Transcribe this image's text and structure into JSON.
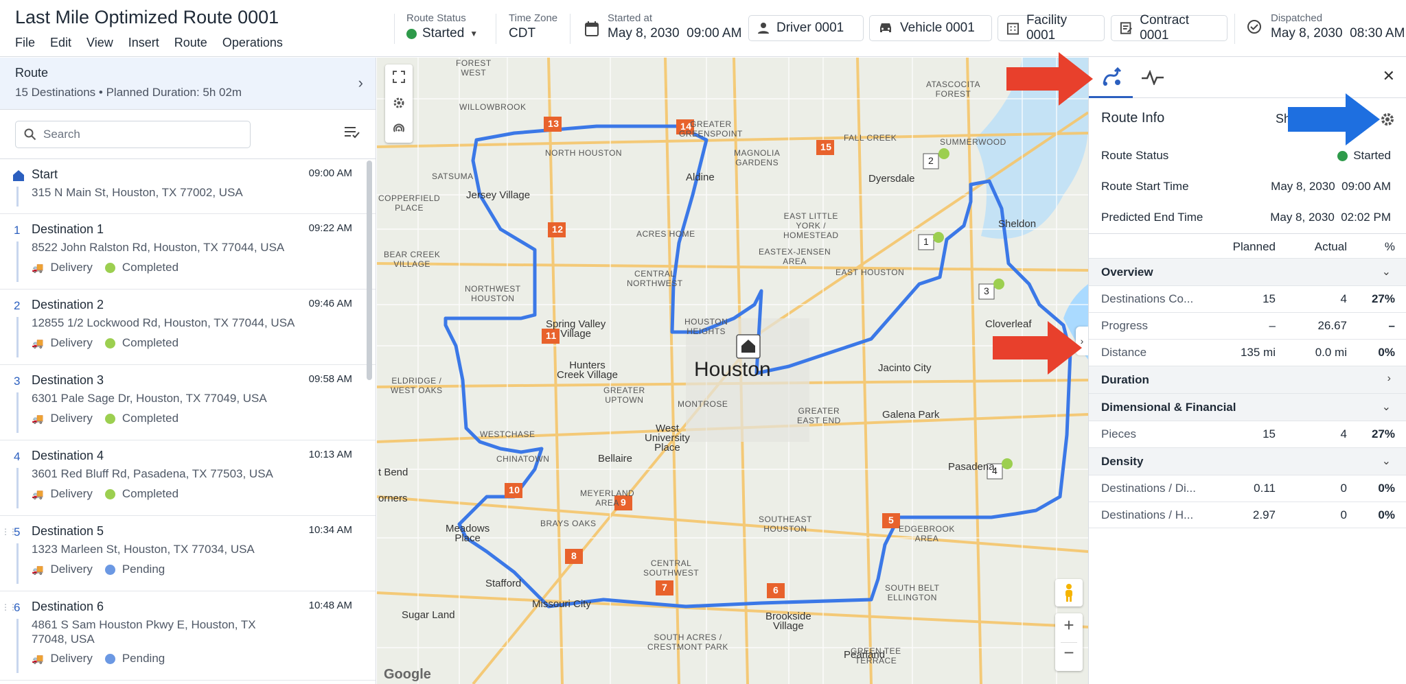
{
  "header": {
    "title": "Last Mile Optimized Route 0001",
    "menu": [
      "File",
      "Edit",
      "View",
      "Insert",
      "Route",
      "Operations"
    ],
    "route_status_label": "Route Status",
    "route_status_value": "Started",
    "time_zone_label": "Time Zone",
    "time_zone_value": "CDT",
    "started_at_label": "Started at",
    "started_at_value": "May 8, 2030  09:00 AM",
    "driver": "Driver 0001",
    "vehicle": "Vehicle 0001",
    "facility": "Facility 0001",
    "contract": "Contract 0001",
    "dispatched_label": "Dispatched",
    "dispatched_value": "May 8, 2030  08:30 AM"
  },
  "left": {
    "route_title": "Route",
    "route_summary": "15 Destinations • Planned Duration: 5h 02m",
    "search_placeholder": "Search",
    "stops": [
      {
        "num": "",
        "name": "Start",
        "time": "09:00 AM",
        "address": "315 N Main St, Houston, TX 77002, USA",
        "type": "",
        "status": ""
      },
      {
        "num": "1",
        "name": "Destination 1",
        "time": "09:22 AM",
        "address": "8522 John Ralston Rd, Houston, TX 77044, USA",
        "type": "Delivery",
        "status": "Completed"
      },
      {
        "num": "2",
        "name": "Destination 2",
        "time": "09:46 AM",
        "address": "12855 1/2 Lockwood Rd, Houston, TX 77044, USA",
        "type": "Delivery",
        "status": "Completed"
      },
      {
        "num": "3",
        "name": "Destination 3",
        "time": "09:58 AM",
        "address": "6301 Pale Sage Dr, Houston, TX 77049, USA",
        "type": "Delivery",
        "status": "Completed"
      },
      {
        "num": "4",
        "name": "Destination 4",
        "time": "10:13 AM",
        "address": "3601 Red Bluff Rd, Pasadena, TX 77503, USA",
        "type": "Delivery",
        "status": "Completed"
      },
      {
        "num": "5",
        "name": "Destination 5",
        "time": "10:34 AM",
        "address": "1323 Marleen St, Houston, TX 77034, USA",
        "type": "Delivery",
        "status": "Pending"
      },
      {
        "num": "6",
        "name": "Destination 6",
        "time": "10:48 AM",
        "address": "4861 S Sam Houston Pkwy E, Houston, TX 77048, USA",
        "type": "Delivery",
        "status": "Pending"
      }
    ]
  },
  "map": {
    "city": "Houston",
    "labels": [
      {
        "text": "FOREST\nWEST"
      },
      {
        "text": "WILLOWBROOK"
      },
      {
        "text": "NORTH HOUSTON"
      },
      {
        "text": "GREATER\nGREENSPOINT"
      },
      {
        "text": "MAGNOLIA\nGARDENS"
      },
      {
        "text": "FALL CREEK"
      },
      {
        "text": "SUMMERWOOD"
      },
      {
        "text": "ATASCOCITA\nFOREST"
      },
      {
        "text": "Aldine"
      },
      {
        "text": "Dyersdale"
      },
      {
        "text": "Jersey Village"
      },
      {
        "text": "ACRES HOME"
      },
      {
        "text": "EAST LITTLE\nYORK /\nHOMESTEAD"
      },
      {
        "text": "EASTEX-JENSEN\nAREA"
      },
      {
        "text": "Sheldon"
      },
      {
        "text": "BEAR CREEK\nVILLAGE"
      },
      {
        "text": "CENTRAL\nNORTHWEST"
      },
      {
        "text": "NORTHWEST\nHOUSTON"
      },
      {
        "text": "EAST HOUSTON"
      },
      {
        "text": "HOUSTON\nHEIGHTS"
      },
      {
        "text": "Spring Valley\nVillage"
      },
      {
        "text": "Cloverleaf"
      },
      {
        "text": "Hunters\nCreek Village"
      },
      {
        "text": "GREATER\nUPTOWN"
      },
      {
        "text": "Jacinto City"
      },
      {
        "text": "ELDRIDGE /\nWEST OAKS"
      },
      {
        "text": "MONTROSE"
      },
      {
        "text": "GREATER\nEAST END"
      },
      {
        "text": "Galena Park"
      },
      {
        "text": "WESTCHASE"
      },
      {
        "text": "West\nUniversity\nPlace"
      },
      {
        "text": "CHINATOWN"
      },
      {
        "text": "Bellaire"
      },
      {
        "text": "Pasadena"
      },
      {
        "text": "MEYERLAND\nAREA"
      },
      {
        "text": "BRAYS OAKS"
      },
      {
        "text": "SOUTHEAST\nHOUSTON"
      },
      {
        "text": "Meadows\nPlace"
      },
      {
        "text": "EDGEBROOK\nAREA"
      },
      {
        "text": "Stafford"
      },
      {
        "text": "CENTRAL\nSOUTHWEST"
      },
      {
        "text": "SOUTH BELT\nELLINGTON"
      },
      {
        "text": "Missouri City"
      },
      {
        "text": "Sugar Land"
      },
      {
        "text": "Brookside\nVillage"
      },
      {
        "text": "SOUTH ACRES /\nCRESTMONT PARK"
      },
      {
        "text": "GREEN TEE\nTERRACE"
      },
      {
        "text": "Pearland"
      },
      {
        "text": "COPPERFIELD\nPLACE"
      },
      {
        "text": "SATSUMA"
      },
      {
        "text": "t Bend"
      },
      {
        "text": "orners"
      }
    ],
    "markers_orange": [
      "13",
      "14",
      "15",
      "12",
      "11",
      "10",
      "9",
      "8",
      "7",
      "6",
      "5"
    ],
    "markers_white": [
      "1",
      "2",
      "3",
      "4"
    ],
    "google": "Google"
  },
  "right": {
    "route_info": "Route Info",
    "show_label": "Sho",
    "route_status_label": "Route Status",
    "route_status_value": "Started",
    "start_time_label": "Route Start Time",
    "start_time_value": "May 8, 2030  09:00 AM",
    "end_time_label": "Predicted End Time",
    "end_time_value": "May 8, 2030  02:02 PM",
    "col_planned": "Planned",
    "col_actual": "Actual",
    "col_pct": "%",
    "sections": [
      {
        "title": "Overview",
        "rows": [
          {
            "name": "Destinations Co...",
            "planned": "15",
            "actual": "4",
            "pct": "27%"
          },
          {
            "name": "Progress",
            "planned": "–",
            "actual": "26.67",
            "pct": "–"
          },
          {
            "name": "Distance",
            "planned": "135 mi",
            "actual": "0.0 mi",
            "pct": "0%"
          }
        ]
      },
      {
        "title": "Duration",
        "rows": []
      },
      {
        "title": "Dimensional & Financial",
        "rows": [
          {
            "name": "Pieces",
            "planned": "15",
            "actual": "4",
            "pct": "27%"
          }
        ]
      },
      {
        "title": "Density",
        "rows": [
          {
            "name": "Destinations / Di...",
            "planned": "0.11",
            "actual": "0",
            "pct": "0%"
          },
          {
            "name": "Destinations / H...",
            "planned": "2.97",
            "actual": "0",
            "pct": "0%"
          }
        ]
      }
    ]
  },
  "colors": {
    "accent": "#2b5fbf",
    "route_line": "#3b78e7",
    "marker_orange": "#e8622c",
    "arrow_red": "#e8402c",
    "arrow_blue": "#1e6fe0",
    "completed": "#9ccf50",
    "pending": "#6b98e3"
  }
}
